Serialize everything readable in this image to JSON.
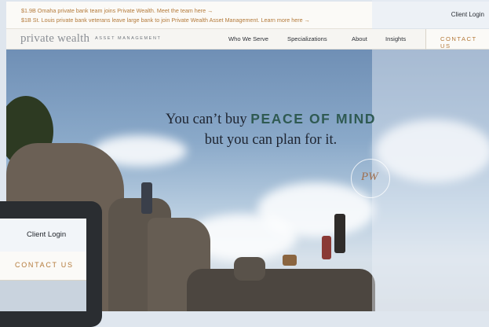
{
  "announcements": [
    "$1.9B Omaha private bank team joins Private Wealth. Meet the team here →",
    "$1B St. Louis private bank veterans leave large bank to join Private Wealth Asset Management. Learn more here →"
  ],
  "client_login": "Client Login",
  "logo": {
    "name": "private wealth",
    "tagline": "ASSET MANAGEMENT"
  },
  "nav": {
    "items": [
      "Who We Serve",
      "Specializations",
      "About",
      "Insights"
    ],
    "contact": "CONTACT US"
  },
  "hero": {
    "line1_prefix": "You can’t buy ",
    "line1_accent": "PEACE OF MIND",
    "line2": "but you can plan for it.",
    "monogram": "PW"
  },
  "device_overlay": {
    "client_login": "Client Login",
    "contact": "CONTACT US"
  },
  "colors": {
    "accent_copper": "#b47a3a",
    "accent_green": "#2f5a52"
  }
}
